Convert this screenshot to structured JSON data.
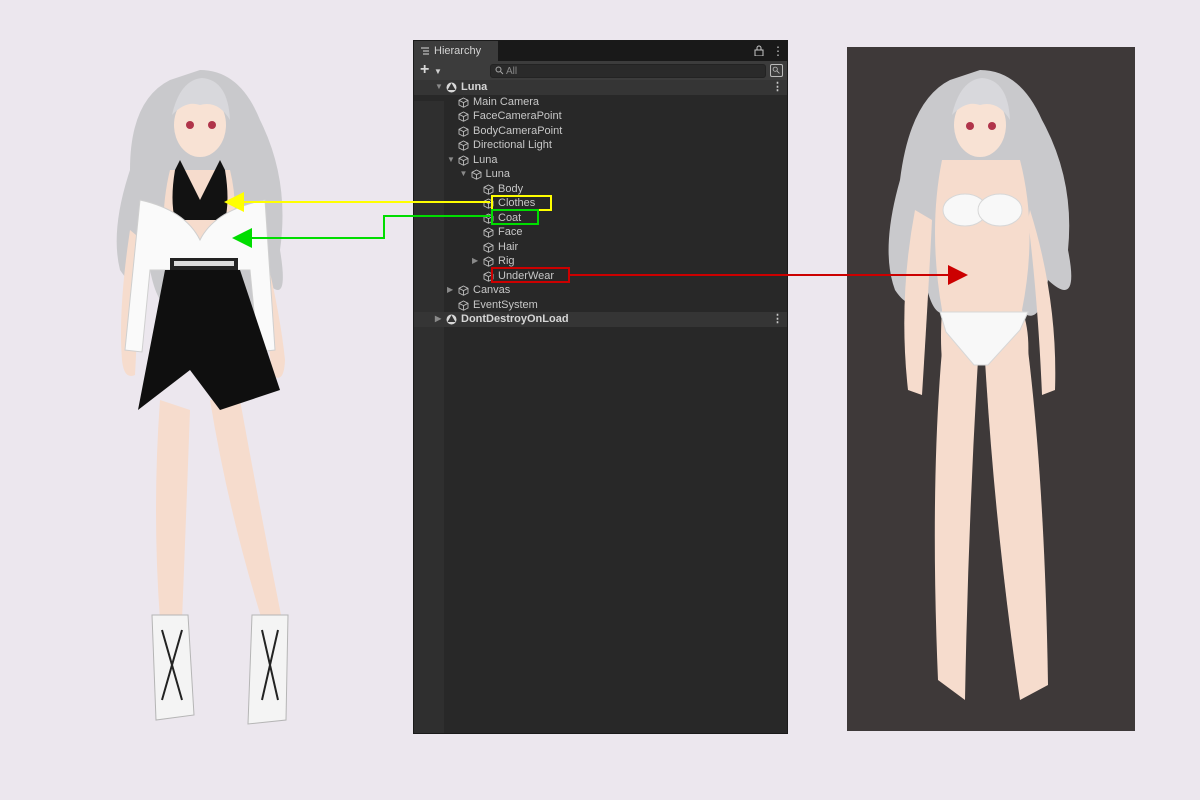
{
  "panel": {
    "tab_label": "Hierarchy",
    "search_placeholder": "All"
  },
  "tree": [
    {
      "label": "Luna",
      "kind": "scene",
      "expanded": true,
      "depth": 0
    },
    {
      "label": "Main Camera",
      "kind": "object",
      "depth": 1
    },
    {
      "label": "FaceCameraPoint",
      "kind": "object",
      "depth": 1
    },
    {
      "label": "BodyCameraPoint",
      "kind": "object",
      "depth": 1
    },
    {
      "label": "Directional Light",
      "kind": "object",
      "depth": 1
    },
    {
      "label": "Luna",
      "kind": "object",
      "expanded": true,
      "depth": 1
    },
    {
      "label": "Luna",
      "kind": "object",
      "expanded": true,
      "depth": 2
    },
    {
      "label": "Body",
      "kind": "object",
      "depth": 3
    },
    {
      "label": "Clothes",
      "kind": "object",
      "depth": 3,
      "highlight": "#ffff00"
    },
    {
      "label": "Coat",
      "kind": "object",
      "depth": 3,
      "highlight": "#00dd00"
    },
    {
      "label": "Face",
      "kind": "object",
      "depth": 3
    },
    {
      "label": "Hair",
      "kind": "object",
      "depth": 3
    },
    {
      "label": "Rig",
      "kind": "object",
      "collapsed": true,
      "depth": 3
    },
    {
      "label": "UnderWear",
      "kind": "object",
      "depth": 3,
      "highlight": "#cc0000"
    },
    {
      "label": "Canvas",
      "kind": "object",
      "collapsed": true,
      "depth": 1
    },
    {
      "label": "EventSystem",
      "kind": "object",
      "depth": 1
    },
    {
      "label": "DontDestroyOnLoad",
      "kind": "scene",
      "collapsed": true,
      "depth": 0
    }
  ],
  "colors": {
    "page_bg": "#ece7ee",
    "panel_bg": "#282828",
    "clothes_arrow": "#ffff00",
    "coat_arrow": "#00dd00",
    "underwear_arrow": "#cc0000",
    "preview_bg": "#3e3939"
  },
  "icons": [
    "hierarchy-list-icon",
    "lock-icon",
    "kebab-menu-icon",
    "plus-icon",
    "search-icon",
    "scene-visibility-icon",
    "unity-scene-icon",
    "gameobject-cube-icon"
  ]
}
